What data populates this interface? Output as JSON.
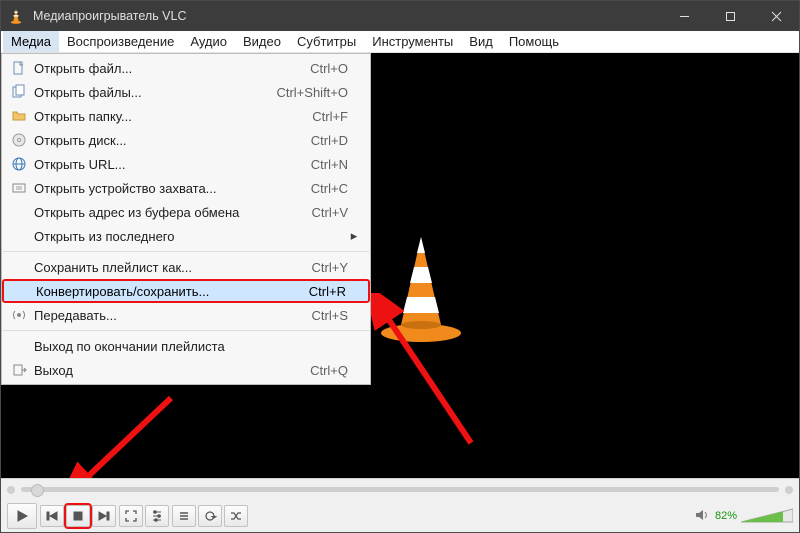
{
  "window": {
    "title": "Медиапроигрыватель VLC"
  },
  "menubar": {
    "items": [
      "Медиа",
      "Воспроизведение",
      "Аудио",
      "Видео",
      "Субтитры",
      "Инструменты",
      "Вид",
      "Помощь"
    ],
    "open_index": 0
  },
  "media_menu": {
    "items": [
      {
        "icon": "file",
        "label": "Открыть файл...",
        "shortcut": "Ctrl+O"
      },
      {
        "icon": "files",
        "label": "Открыть файлы...",
        "shortcut": "Ctrl+Shift+O"
      },
      {
        "icon": "folder",
        "label": "Открыть папку...",
        "shortcut": "Ctrl+F"
      },
      {
        "icon": "disc",
        "label": "Открыть диск...",
        "shortcut": "Ctrl+D"
      },
      {
        "icon": "network",
        "label": "Открыть URL...",
        "shortcut": "Ctrl+N"
      },
      {
        "icon": "capture",
        "label": "Открыть устройство захвата...",
        "shortcut": "Ctrl+C"
      },
      {
        "icon": "clipboard",
        "label": "Открыть адрес из буфера обмена",
        "shortcut": "Ctrl+V"
      },
      {
        "icon": "recent",
        "label": "Открыть из последнего",
        "shortcut": "",
        "submenu": true
      },
      {
        "sep": true
      },
      {
        "icon": "",
        "label": "Сохранить плейлист как...",
        "shortcut": "Ctrl+Y"
      },
      {
        "icon": "",
        "label": "Конвертировать/сохранить...",
        "shortcut": "Ctrl+R",
        "highlight": true
      },
      {
        "icon": "stream",
        "label": "Передавать...",
        "shortcut": "Ctrl+S"
      },
      {
        "sep": true
      },
      {
        "icon": "",
        "label": "Выход по окончании плейлиста",
        "shortcut": ""
      },
      {
        "icon": "quit",
        "label": "Выход",
        "shortcut": "Ctrl+Q"
      }
    ]
  },
  "volume": {
    "percent": "82%"
  }
}
